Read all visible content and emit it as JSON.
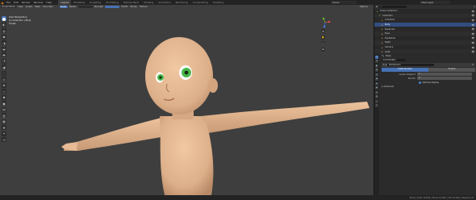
{
  "topbar": {
    "menus": [
      "File",
      "Edit",
      "Render",
      "Window",
      "Help"
    ],
    "workspaces": [
      "Layout",
      "Modeling",
      "Sculpting",
      "UV Editing",
      "Texture Paint",
      "Shading",
      "Animation",
      "Rendering",
      "Compositing",
      "Scripting"
    ],
    "active_workspace": "Layout",
    "scene": "Scene",
    "view_layer": "View Layer"
  },
  "viewport": {
    "header": {
      "mode": "Sculpt Mode",
      "menus": [
        "View",
        "Sculpt",
        "Mask",
        "Face Sets"
      ],
      "brush": "Draw",
      "radius_label": "Radius",
      "strength_label": "Strength",
      "falloff_label": "Falloff",
      "stroke_label": "Stroke",
      "texture_label": "Texture",
      "options": "Options"
    },
    "overlay_lines": [
      "User Perspective",
      "(1) Collection | Body",
      "Sculpt"
    ],
    "tools": [
      "⬤",
      "◐",
      "◍",
      "◉",
      "◑",
      "◒",
      "◓",
      "◔",
      "◕",
      "◌",
      "◎",
      "◈",
      "◇",
      "◆",
      "▣",
      "▤",
      "▥",
      "▦",
      "✥",
      "✦",
      "⟲"
    ],
    "gizmos": [
      "✥",
      "✋",
      "🎥",
      "⊞"
    ]
  },
  "outliner": {
    "search": "",
    "rows": [
      {
        "icon": "▸",
        "label": "Scene Collection",
        "vis": "👁"
      },
      {
        "icon": "▾",
        "label": "Collection",
        "vis": "👁"
      },
      {
        "icon": "▸",
        "label": "Armature",
        "vis": "👁"
      },
      {
        "icon": "▸",
        "label": "Body",
        "vis": "👁"
      },
      {
        "icon": "▸",
        "label": "Eyebrows",
        "vis": "👁"
      },
      {
        "icon": "▸",
        "label": "Eyes",
        "vis": "👁"
      },
      {
        "icon": "▸",
        "label": "Eyelashes",
        "vis": "👁"
      },
      {
        "icon": "▸",
        "label": "Teeth",
        "vis": "👁"
      },
      {
        "icon": "▸",
        "label": "Camera",
        "vis": "👁"
      },
      {
        "icon": "▸",
        "label": "Light",
        "vis": "👁"
      }
    ],
    "selected_index": 3
  },
  "properties": {
    "object_name": "Body",
    "section": "Subdivision",
    "modifier_name": "Subdivision",
    "tabs": [
      "Catmull-Clark",
      "Simple"
    ],
    "fields": [
      {
        "label": "Levels Viewport",
        "value": "1"
      },
      {
        "label": "Render",
        "value": "2"
      }
    ],
    "optimal_display": "Optimal Display",
    "advanced": "Advanced",
    "add_modifier": "Add Modifier"
  },
  "statusbar": {
    "left": "",
    "right": "Body | Verts 12,842 | Faces 12,810 | Tris 25,620 | Objects 1/9"
  },
  "colors": {
    "accent": "#4772b3",
    "viewport_bg": "#3e3e3e",
    "skin": "#e2b48f",
    "iris": "#49b84a"
  }
}
